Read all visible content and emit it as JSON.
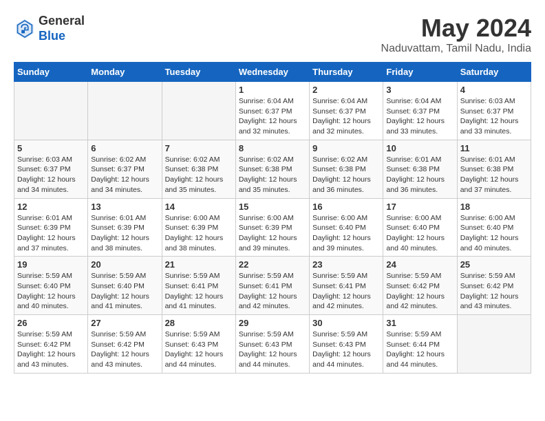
{
  "header": {
    "logo_line1": "General",
    "logo_line2": "Blue",
    "month": "May 2024",
    "location": "Naduvattam, Tamil Nadu, India"
  },
  "days_of_week": [
    "Sunday",
    "Monday",
    "Tuesday",
    "Wednesday",
    "Thursday",
    "Friday",
    "Saturday"
  ],
  "weeks": [
    [
      {
        "day": "",
        "info": ""
      },
      {
        "day": "",
        "info": ""
      },
      {
        "day": "",
        "info": ""
      },
      {
        "day": "1",
        "info": "Sunrise: 6:04 AM\nSunset: 6:37 PM\nDaylight: 12 hours\nand 32 minutes."
      },
      {
        "day": "2",
        "info": "Sunrise: 6:04 AM\nSunset: 6:37 PM\nDaylight: 12 hours\nand 32 minutes."
      },
      {
        "day": "3",
        "info": "Sunrise: 6:04 AM\nSunset: 6:37 PM\nDaylight: 12 hours\nand 33 minutes."
      },
      {
        "day": "4",
        "info": "Sunrise: 6:03 AM\nSunset: 6:37 PM\nDaylight: 12 hours\nand 33 minutes."
      }
    ],
    [
      {
        "day": "5",
        "info": "Sunrise: 6:03 AM\nSunset: 6:37 PM\nDaylight: 12 hours\nand 34 minutes."
      },
      {
        "day": "6",
        "info": "Sunrise: 6:02 AM\nSunset: 6:37 PM\nDaylight: 12 hours\nand 34 minutes."
      },
      {
        "day": "7",
        "info": "Sunrise: 6:02 AM\nSunset: 6:38 PM\nDaylight: 12 hours\nand 35 minutes."
      },
      {
        "day": "8",
        "info": "Sunrise: 6:02 AM\nSunset: 6:38 PM\nDaylight: 12 hours\nand 35 minutes."
      },
      {
        "day": "9",
        "info": "Sunrise: 6:02 AM\nSunset: 6:38 PM\nDaylight: 12 hours\nand 36 minutes."
      },
      {
        "day": "10",
        "info": "Sunrise: 6:01 AM\nSunset: 6:38 PM\nDaylight: 12 hours\nand 36 minutes."
      },
      {
        "day": "11",
        "info": "Sunrise: 6:01 AM\nSunset: 6:38 PM\nDaylight: 12 hours\nand 37 minutes."
      }
    ],
    [
      {
        "day": "12",
        "info": "Sunrise: 6:01 AM\nSunset: 6:39 PM\nDaylight: 12 hours\nand 37 minutes."
      },
      {
        "day": "13",
        "info": "Sunrise: 6:01 AM\nSunset: 6:39 PM\nDaylight: 12 hours\nand 38 minutes."
      },
      {
        "day": "14",
        "info": "Sunrise: 6:00 AM\nSunset: 6:39 PM\nDaylight: 12 hours\nand 38 minutes."
      },
      {
        "day": "15",
        "info": "Sunrise: 6:00 AM\nSunset: 6:39 PM\nDaylight: 12 hours\nand 39 minutes."
      },
      {
        "day": "16",
        "info": "Sunrise: 6:00 AM\nSunset: 6:40 PM\nDaylight: 12 hours\nand 39 minutes."
      },
      {
        "day": "17",
        "info": "Sunrise: 6:00 AM\nSunset: 6:40 PM\nDaylight: 12 hours\nand 40 minutes."
      },
      {
        "day": "18",
        "info": "Sunrise: 6:00 AM\nSunset: 6:40 PM\nDaylight: 12 hours\nand 40 minutes."
      }
    ],
    [
      {
        "day": "19",
        "info": "Sunrise: 5:59 AM\nSunset: 6:40 PM\nDaylight: 12 hours\nand 40 minutes."
      },
      {
        "day": "20",
        "info": "Sunrise: 5:59 AM\nSunset: 6:40 PM\nDaylight: 12 hours\nand 41 minutes."
      },
      {
        "day": "21",
        "info": "Sunrise: 5:59 AM\nSunset: 6:41 PM\nDaylight: 12 hours\nand 41 minutes."
      },
      {
        "day": "22",
        "info": "Sunrise: 5:59 AM\nSunset: 6:41 PM\nDaylight: 12 hours\nand 42 minutes."
      },
      {
        "day": "23",
        "info": "Sunrise: 5:59 AM\nSunset: 6:41 PM\nDaylight: 12 hours\nand 42 minutes."
      },
      {
        "day": "24",
        "info": "Sunrise: 5:59 AM\nSunset: 6:42 PM\nDaylight: 12 hours\nand 42 minutes."
      },
      {
        "day": "25",
        "info": "Sunrise: 5:59 AM\nSunset: 6:42 PM\nDaylight: 12 hours\nand 43 minutes."
      }
    ],
    [
      {
        "day": "26",
        "info": "Sunrise: 5:59 AM\nSunset: 6:42 PM\nDaylight: 12 hours\nand 43 minutes."
      },
      {
        "day": "27",
        "info": "Sunrise: 5:59 AM\nSunset: 6:42 PM\nDaylight: 12 hours\nand 43 minutes."
      },
      {
        "day": "28",
        "info": "Sunrise: 5:59 AM\nSunset: 6:43 PM\nDaylight: 12 hours\nand 44 minutes."
      },
      {
        "day": "29",
        "info": "Sunrise: 5:59 AM\nSunset: 6:43 PM\nDaylight: 12 hours\nand 44 minutes."
      },
      {
        "day": "30",
        "info": "Sunrise: 5:59 AM\nSunset: 6:43 PM\nDaylight: 12 hours\nand 44 minutes."
      },
      {
        "day": "31",
        "info": "Sunrise: 5:59 AM\nSunset: 6:44 PM\nDaylight: 12 hours\nand 44 minutes."
      },
      {
        "day": "",
        "info": ""
      }
    ]
  ]
}
